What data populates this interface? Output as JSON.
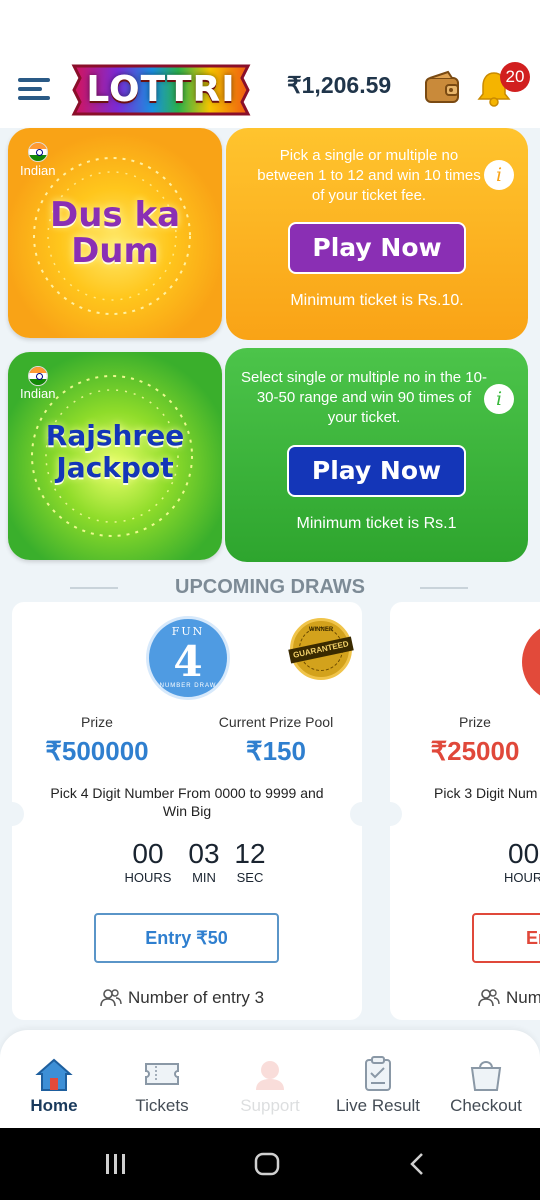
{
  "header": {
    "logo_text": "LOTTRI",
    "balance": "₹1,206.59",
    "notification_count": "20",
    "icons": {
      "menu": "hamburger-icon",
      "wallet": "wallet-icon",
      "bell": "bell-icon"
    }
  },
  "games": [
    {
      "flag_label": "Indian",
      "title_line1": "Dus ka",
      "title_line2": "Dum",
      "description": "Pick a single or multiple no between 1 to 12 and win 10 times of your ticket fee.",
      "play_label": "Play Now",
      "min_ticket": "Minimum ticket is Rs.10.",
      "info_symbol": "i",
      "colors": {
        "tile": "#f9a316",
        "button": "#8a2fb4",
        "title": "#8a2fb4"
      }
    },
    {
      "flag_label": "Indian",
      "title_line1": "Rajshree",
      "title_line2": "Jackpot",
      "description": "Select single or multiple no in the 10-30-50 range and win 90 times of your ticket.",
      "play_label": "Play Now",
      "min_ticket": "Minimum ticket is Rs.1",
      "info_symbol": "i",
      "colors": {
        "tile": "#37b83a",
        "button": "#1436b8",
        "title": "#1436b8"
      }
    }
  ],
  "upcoming": {
    "section_title": "UPCOMING DRAWS",
    "cards": [
      {
        "badge": {
          "top": "FUN",
          "number": "4",
          "bottom": "NUMBER DRAW"
        },
        "seal_text": "GUARANTEED",
        "seal_small": "WINNER",
        "prize_label": "Prize",
        "prize_value": "₹500000",
        "pool_label": "Current Prize Pool",
        "pool_value": "₹150",
        "pick_text": "Pick 4 Digit Number From 0000 to 9999 and Win Big",
        "timer": {
          "hours": "00",
          "minutes": "03",
          "seconds": "12",
          "hours_label": "HOURS",
          "minutes_label": "MIN",
          "seconds_label": "SEC"
        },
        "entry_label": "Entry ₹50",
        "entries_text": "Number of entry 3"
      },
      {
        "prize_label": "Prize",
        "prize_value": "₹25000",
        "pick_text": "Pick 3 Digit Num",
        "timer_hours": "00",
        "hours_label": "HOUR",
        "entry_label": "Er",
        "entries_text": "Num"
      }
    ]
  },
  "nav": {
    "items": [
      {
        "label": "Home",
        "icon": "home-icon",
        "active": true
      },
      {
        "label": "Tickets",
        "icon": "ticket-icon",
        "active": false
      },
      {
        "label": "Support",
        "icon": "support-icon",
        "active": false
      },
      {
        "label": "Live Result",
        "icon": "clipboard-icon",
        "active": false
      },
      {
        "label": "Checkout",
        "icon": "shopping-bag-icon",
        "active": false
      }
    ]
  },
  "system_bar": {
    "icons": [
      "recent-apps-icon",
      "home-button-icon",
      "back-icon"
    ]
  }
}
